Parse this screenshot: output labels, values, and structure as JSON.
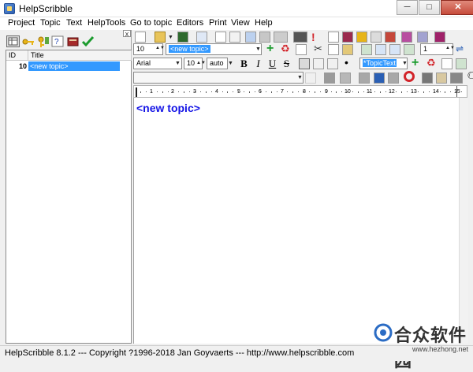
{
  "window": {
    "title": "HelpScribble",
    "controls": {
      "minimize": "─",
      "maximize": "□",
      "close": "✕"
    }
  },
  "menu": [
    "Project",
    "Topic",
    "Text",
    "HelpTools",
    "Go to topic",
    "Editors",
    "Print",
    "View",
    "Help"
  ],
  "left_panel": {
    "close_label": "x",
    "columns": [
      "ID",
      "Title"
    ],
    "rows": [
      {
        "id": "10",
        "title": "<new topic>"
      }
    ]
  },
  "toolbar": {
    "topic_number": "10",
    "topic_name": "<new topic>",
    "font_name": "Arial",
    "font_size": "10",
    "size_mode": "auto",
    "style_name": "*TopicText",
    "page_value": "1",
    "bold": "B",
    "italic": "I",
    "underline": "U",
    "strike": "S"
  },
  "ruler": {
    "numbers": [
      "1",
      "2",
      "3",
      "4",
      "5",
      "6",
      "7",
      "8",
      "9",
      "10",
      "11",
      "12",
      "13",
      "14",
      "15"
    ]
  },
  "editor": {
    "content": "<new topic>"
  },
  "statusbar": {
    "text": "HelpScribble 8.1.2   ---   Copyright ?1996-2018  Jan Goyvaerts   ---   http://www.helpscribble.com"
  },
  "watermark": {
    "text": "合众软件园",
    "url": "www.hezhong.net"
  },
  "colors": {
    "selection": "#3399ff",
    "topic_text": "#1414e6",
    "accent_green": "#1b9b2e",
    "accent_red": "#d2242a"
  }
}
